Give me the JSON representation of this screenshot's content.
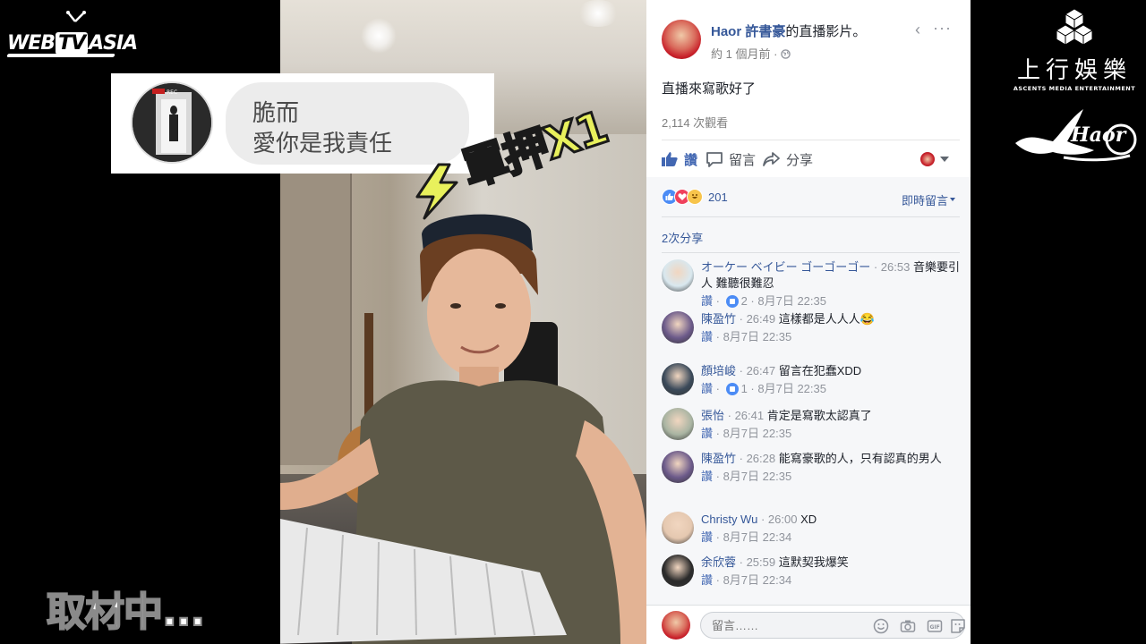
{
  "overlay_logos": {
    "webtv": {
      "text_left": "WEB",
      "text_box": "TV",
      "text_right": "ASIA"
    },
    "ascents": {
      "chinese": "上行娛樂",
      "english": "ASCENTS MEDIA ENTERTAINMENT"
    },
    "haor": {
      "text": "Haor"
    }
  },
  "caption": "取材中...",
  "comment_overlay": {
    "line1": "脆而",
    "line2": "愛你是我責任",
    "avatar_badge": "REC"
  },
  "stamp_text": "單押X1",
  "facebook": {
    "author_name": "Haor 許書豪",
    "author_suffix": "的直播影片。",
    "timestamp": "約 1 個月前 · ",
    "post_text": "直播來寫歌好了",
    "views": "2,114 次觀看",
    "actions": {
      "like": "讚",
      "comment": "留言",
      "share": "分享"
    },
    "reaction_count": "201",
    "sort_label": "即時留言",
    "shares": "2次分享",
    "comments": [
      {
        "name": "オーケー ベイビー ゴーゴーゴー",
        "time": "26:53",
        "text": "音樂要引人 難聽很難忍",
        "like_label": "讚",
        "likes": "2",
        "date": "8月7日 22:35",
        "avatar_color": "#d9e8ef"
      },
      {
        "name": "陳盈竹",
        "time": "26:49",
        "text": "這樣都是人人人😂",
        "like_label": "讚",
        "likes": "",
        "date": "8月7日 22:35",
        "avatar_color": "#6c5a8a"
      },
      {
        "name": "顏培峻",
        "time": "26:47",
        "text": "留言在犯蠢XDD",
        "like_label": "讚",
        "likes": "1",
        "date": "8月7日 22:35",
        "avatar_color": "#3b4a5a"
      },
      {
        "name": "張怡",
        "time": "26:41",
        "text": "肯定是寫歌太認真了",
        "like_label": "讚",
        "likes": "",
        "date": "8月7日 22:35",
        "avatar_color": "#a9b4a2"
      },
      {
        "name": "陳盈竹",
        "time": "26:28",
        "text": "能寫豪歌的人，只有認真的男人",
        "like_label": "讚",
        "likes": "",
        "date": "8月7日 22:35",
        "avatar_color": "#6c5a8a"
      },
      {
        "name": "Christy Wu",
        "time": "26:00",
        "text": "XD",
        "like_label": "讚",
        "likes": "",
        "date": "8月7日 22:34",
        "avatar_color": "#e5c8b0"
      },
      {
        "name": "余欣蓉",
        "time": "25:59",
        "text": "這默契我爆笑",
        "like_label": "讚",
        "likes": "",
        "date": "8月7日 22:34",
        "avatar_color": "#2b2b2b"
      }
    ],
    "compose_placeholder": "留言……"
  },
  "colors": {
    "fb_link": "#365899",
    "fb_like": "#4267b2",
    "stamp_yellow": "#e8f05c"
  }
}
